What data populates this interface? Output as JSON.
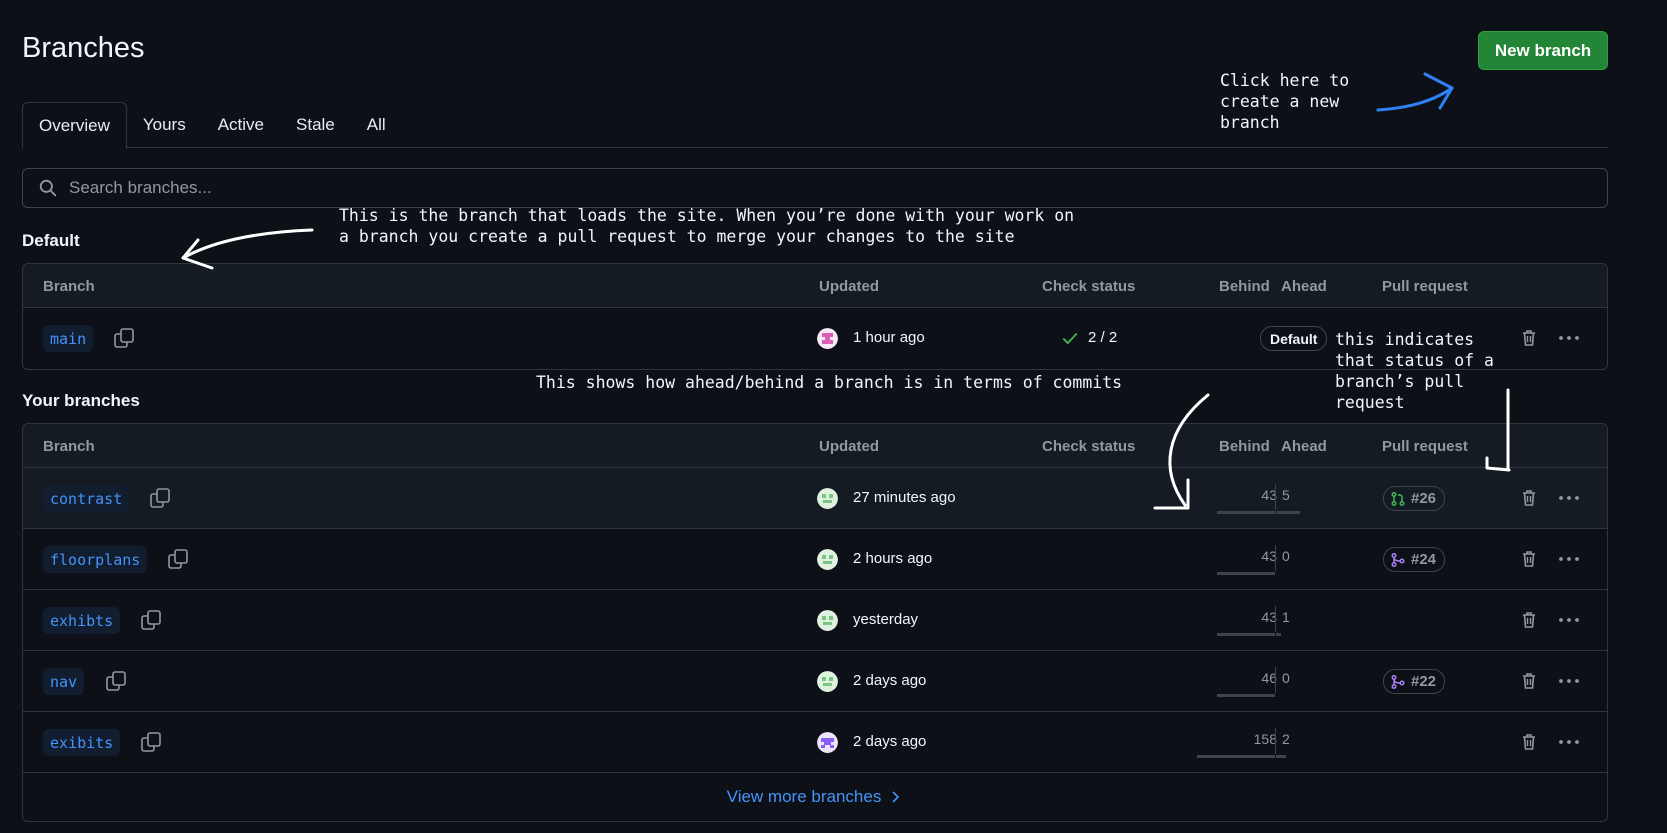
{
  "header": {
    "title": "Branches",
    "new_branch_label": "New branch"
  },
  "tabs": [
    {
      "label": "Overview",
      "active": true
    },
    {
      "label": "Yours",
      "active": false
    },
    {
      "label": "Active",
      "active": false
    },
    {
      "label": "Stale",
      "active": false
    },
    {
      "label": "All",
      "active": false
    }
  ],
  "search": {
    "placeholder": "Search branches..."
  },
  "columns": {
    "branch": "Branch",
    "updated": "Updated",
    "check_status": "Check status",
    "behind": "Behind",
    "ahead": "Ahead",
    "pull_request": "Pull request"
  },
  "default_section": {
    "title": "Default",
    "row": {
      "name": "main",
      "updated": "1 hour ago",
      "check": "2 / 2",
      "badge": "Default"
    }
  },
  "your_branches": {
    "title": "Your branches",
    "rows": [
      {
        "name": "contrast",
        "updated": "27 minutes ago",
        "behind": "43",
        "ahead": "5",
        "pr": "#26",
        "pr_state": "open"
      },
      {
        "name": "floorplans",
        "updated": "2 hours ago",
        "behind": "43",
        "ahead": "0",
        "pr": "#24",
        "pr_state": "merged"
      },
      {
        "name": "exhibts",
        "updated": "yesterday",
        "behind": "43",
        "ahead": "1",
        "pr": "",
        "pr_state": ""
      },
      {
        "name": "nav",
        "updated": "2 days ago",
        "behind": "46",
        "ahead": "0",
        "pr": "#22",
        "pr_state": "merged"
      },
      {
        "name": "exibits",
        "updated": "2 days ago",
        "behind": "158",
        "ahead": "2",
        "pr": "",
        "pr_state": ""
      }
    ],
    "view_more": "View more branches"
  },
  "annotations": {
    "new_branch_note": "Click here to\ncreate a new\nbranch",
    "default_note": "This is the branch that loads the site. When you’re done with your work on\na branch you create a pull request to merge your changes to the site",
    "ahead_behind_note": "This shows how ahead/behind a branch is in terms of commits",
    "pr_note": "this indicates\nthat status of a\nbranch’s pull\nrequest"
  },
  "colors": {
    "accent": "#4493f8",
    "primary_button": "#238636",
    "open_pr": "#3fb950",
    "merged_pr": "#ab7df8",
    "background": "#0d1117"
  },
  "icons": [
    "search-icon",
    "copy-icon",
    "check-icon",
    "trash-icon",
    "kebab-icon",
    "git-pull-request-icon",
    "git-merge-icon",
    "chevron-right-icon"
  ]
}
